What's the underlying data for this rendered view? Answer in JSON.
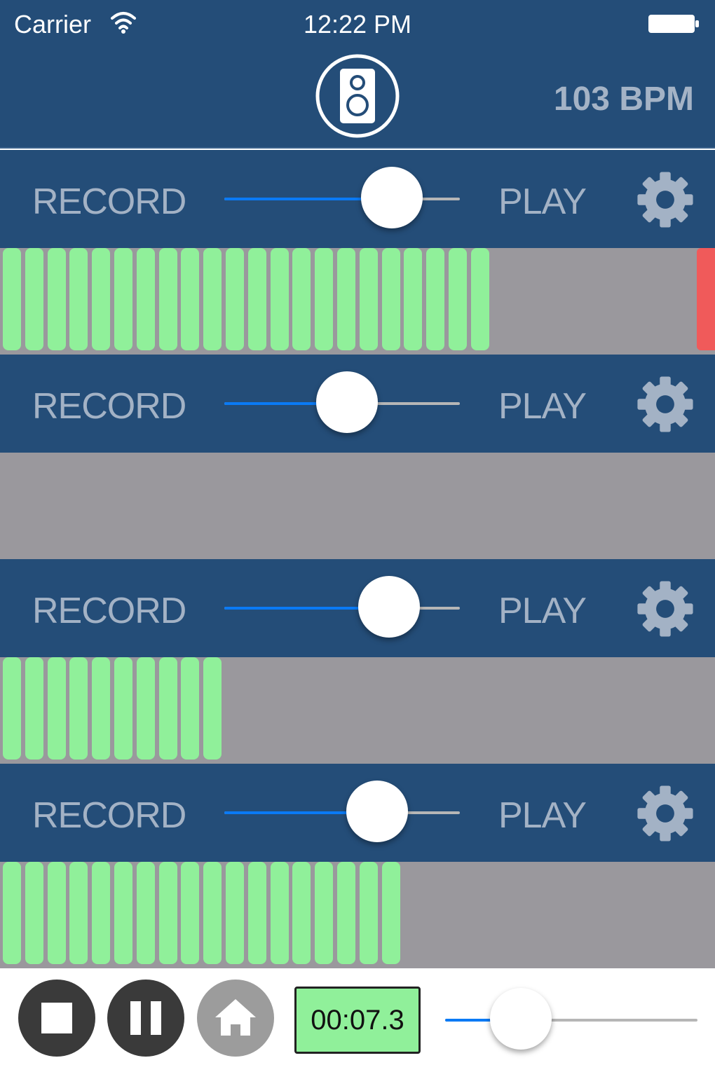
{
  "status_bar": {
    "carrier": "Carrier",
    "time": "12:22 PM"
  },
  "header": {
    "bpm": "103 BPM",
    "icon": "speaker-icon"
  },
  "tracks": [
    {
      "record_label": "RECORD",
      "play_label": "PLAY",
      "mix_level": 0.71,
      "meter_segments": 22,
      "clip": true
    },
    {
      "record_label": "RECORD",
      "play_label": "PLAY",
      "mix_level": 0.52,
      "meter_segments": 0,
      "clip": false
    },
    {
      "record_label": "RECORD",
      "play_label": "PLAY",
      "mix_level": 0.7,
      "meter_segments": 10,
      "clip": false
    },
    {
      "record_label": "RECORD",
      "play_label": "PLAY",
      "mix_level": 0.65,
      "meter_segments": 18,
      "clip": false
    }
  ],
  "transport": {
    "timer": "00:07.3",
    "position_level": 0.3,
    "icons": [
      "stop-icon",
      "pause-icon",
      "home-icon"
    ]
  },
  "colors": {
    "header_bg": "#244d78",
    "label": "#a3b2c5",
    "meter_green": "#90f09a",
    "meter_bg": "#9a989d",
    "clip_red": "#f05a5a",
    "slider_blue": "#0a7af5"
  }
}
